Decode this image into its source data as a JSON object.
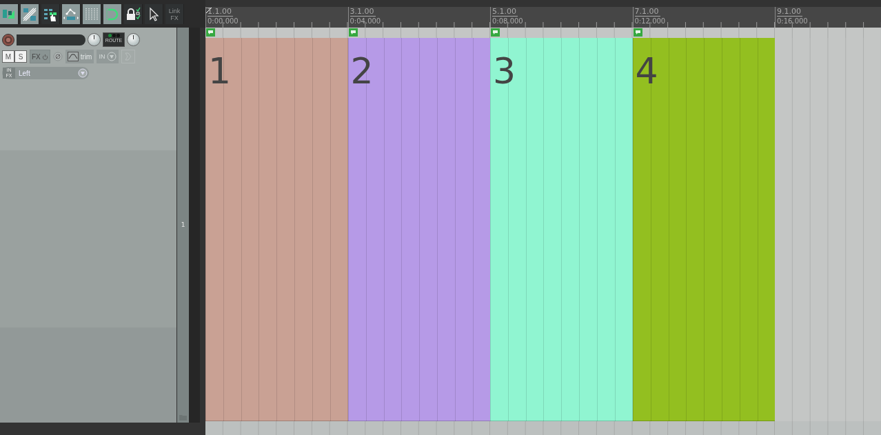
{
  "toolbar": [
    {
      "kind": "snap",
      "on": true
    },
    {
      "kind": "ripple",
      "on": true
    },
    {
      "kind": "grouping",
      "on": false
    },
    {
      "kind": "envelope",
      "on": true
    },
    {
      "kind": "grid",
      "on": true
    },
    {
      "kind": "loop",
      "on": true
    },
    {
      "kind": "lock",
      "on": false
    },
    {
      "kind": "pointer",
      "on": false
    },
    {
      "kind": "text",
      "on": false,
      "lines": [
        "Link",
        "FX"
      ]
    }
  ],
  "track": {
    "number": "1",
    "mute": {
      "label": "M",
      "on": false
    },
    "solo": {
      "label": "S",
      "on": false
    },
    "fx": "FX",
    "trim": "trim",
    "input_button": "IN",
    "route": "ROUTE",
    "input_badge": [
      "IN",
      "FX"
    ],
    "input": "Left"
  },
  "ruler": [
    {
      "bar": "1.1.00",
      "time": "0:00.000"
    },
    {
      "bar": "3.1.00",
      "time": "0:04.000"
    },
    {
      "bar": "5.1.00",
      "time": "0:08.000"
    },
    {
      "bar": "7.1.00",
      "time": "0:12.000"
    },
    {
      "bar": "9.1.00",
      "time": "0:16.000"
    }
  ],
  "regions": [
    {
      "number": "1",
      "color": "#c9a194"
    },
    {
      "number": "2",
      "color": "#b69ae7"
    },
    {
      "number": "3",
      "color": "#90f5d1"
    },
    {
      "number": "4",
      "color": "#93bf20"
    }
  ]
}
